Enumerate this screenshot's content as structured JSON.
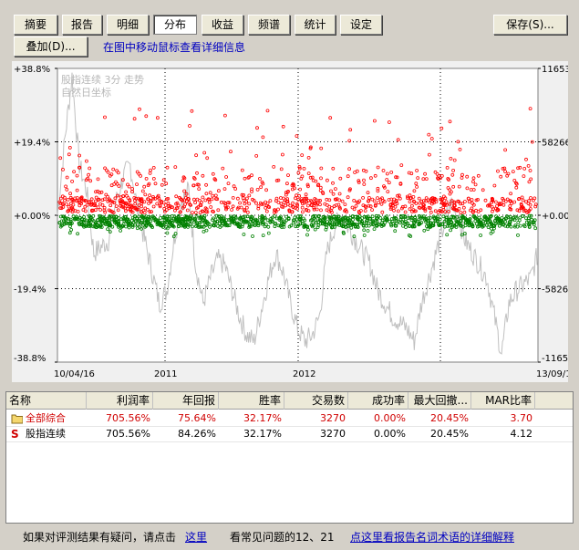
{
  "tabs": [
    {
      "label": "摘要",
      "active": false
    },
    {
      "label": "报告",
      "active": false
    },
    {
      "label": "明细",
      "active": false
    },
    {
      "label": "分布",
      "active": true
    },
    {
      "label": "收益",
      "active": false
    },
    {
      "label": "频谱",
      "active": false
    },
    {
      "label": "统计",
      "active": false
    },
    {
      "label": "设定",
      "active": false
    }
  ],
  "toolbar": {
    "save_label": "保存(S)...",
    "overlay_label": "叠加(D)...",
    "hint": "在图中移动鼠标查看详细信息"
  },
  "chart_data": {
    "type": "scatter",
    "legend": [
      "股指连续 3分 走势",
      "自然日坐标"
    ],
    "left_ticks": [
      "+38.8%",
      "+19.4%",
      "+0.00%",
      "-19.4%",
      "-38.8%"
    ],
    "right_ticks": [
      "116531",
      "58266",
      "+0.00",
      "-58266",
      "-116531"
    ],
    "x_labels": [
      "10/04/16",
      "2011",
      "2012",
      "13/09/1"
    ],
    "ylim_left": [
      -38.8,
      38.8
    ],
    "ylim_right": [
      -116531,
      116531
    ],
    "x_range": [
      "10/04/16",
      "13/09/1"
    ],
    "series": [
      {
        "name": "",
        "color": "#ff0000",
        "description_marks": "positive returns scatter"
      },
      {
        "name": "",
        "color": "#008000",
        "description_marks": "negative returns scatter"
      },
      {
        "name": "",
        "color": "#c0c0c0",
        "description_marks": "equity line"
      }
    ],
    "equity_curve": [
      0,
      60000,
      110000,
      40000,
      20000,
      -30000,
      -25000,
      -20000,
      10000,
      30000,
      40000,
      5000,
      -20000,
      -45000,
      -70000,
      -60000,
      -20000,
      10000,
      20000,
      -40000,
      -70000,
      -50000,
      -35000,
      -40000,
      -60000,
      -80000,
      -95000,
      -100000,
      -75000,
      -50000,
      -30000,
      -45000,
      -70000,
      -90000,
      -100000,
      -95000,
      -80000,
      -30000,
      -10000,
      0,
      -10000,
      -20000,
      -30000,
      -40000,
      -60000,
      -70000,
      -80000,
      -85000,
      -90000,
      -100000,
      -70000,
      -50000,
      -30000,
      -10000,
      10000,
      0,
      -20000,
      -30000,
      -40000,
      -50000,
      -80000,
      -110000,
      -70000,
      -60000,
      -55000,
      -50000,
      -30000
    ]
  },
  "table": {
    "headers": [
      "名称",
      "利润率",
      "年回报",
      "胜率",
      "交易数",
      "成功率",
      "最大回撤...",
      "MAR比率"
    ],
    "rows": [
      {
        "icon": "folder-icon",
        "name": "全部综合",
        "red": true,
        "values": [
          "705.56%",
          "75.64%",
          "32.17%",
          "3270",
          "0.00%",
          "20.45%",
          "3.70"
        ]
      },
      {
        "icon": "s-icon",
        "name": "股指连续",
        "red": false,
        "values": [
          "705.56%",
          "84.26%",
          "32.17%",
          "3270",
          "0.00%",
          "20.45%",
          "4.12"
        ]
      }
    ]
  },
  "footer": {
    "question_text": "如果对评测结果有疑问，请点击",
    "here_link": "这里",
    "faq_text": "看常见问题的12、21",
    "glossary_link": "点这里看报告名词术语的详细解释"
  },
  "colors": {
    "positive": "#ff0000",
    "negative": "#008000",
    "equity": "#c0c0c0"
  }
}
